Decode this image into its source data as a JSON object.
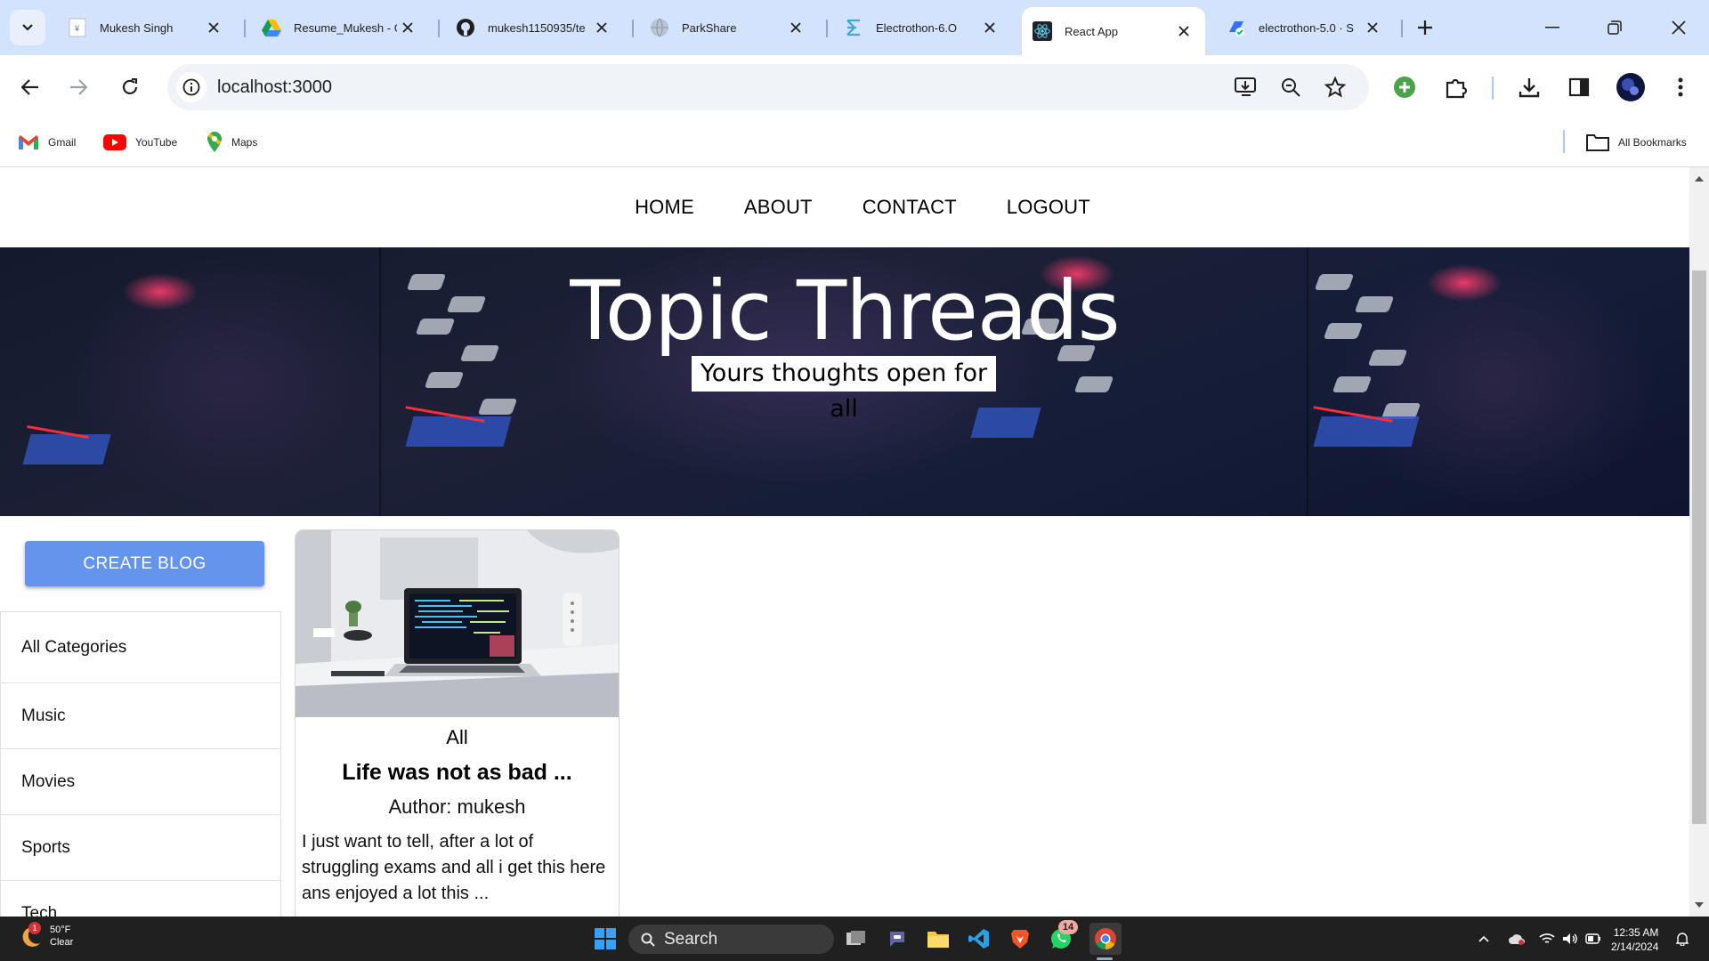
{
  "browser": {
    "tabs": [
      {
        "title": "Mukesh Singh",
        "favicon": "document-icon",
        "active": false
      },
      {
        "title": "Resume_Mukesh - G",
        "favicon": "google-drive-icon",
        "active": false
      },
      {
        "title": "mukesh1150935/te",
        "favicon": "github-icon",
        "active": false
      },
      {
        "title": "ParkShare",
        "favicon": "globe-icon",
        "active": false
      },
      {
        "title": "Electrothon-6.O",
        "favicon": "electrothon-icon",
        "active": false
      },
      {
        "title": "React App",
        "favicon": "react-icon",
        "active": true
      },
      {
        "title": "electrothon-5.0 · S",
        "favicon": "devfolio-icon",
        "active": false
      }
    ],
    "address": "localhost:3000",
    "bookmarks": [
      {
        "label": "Gmail",
        "icon": "gmail-icon"
      },
      {
        "label": "YouTube",
        "icon": "youtube-icon"
      },
      {
        "label": "Maps",
        "icon": "maps-icon"
      }
    ],
    "all_bookmarks_label": "All Bookmarks"
  },
  "page": {
    "nav": [
      "HOME",
      "ABOUT",
      "CONTACT",
      "LOGOUT"
    ],
    "banner": {
      "title": "Topic Threads",
      "subtitle": "Yours thoughts open for all"
    },
    "create_button": "CREATE BLOG",
    "categories": [
      "All Categories",
      "Music",
      "Movies",
      "Sports",
      "Tech"
    ],
    "post": {
      "category": "All",
      "title": "Life was not as bad ...",
      "author": "Author: mukesh",
      "description": "I just want to tell, after a lot of struggling exams and all i get this here ans enjoyed a lot this ..."
    }
  },
  "taskbar": {
    "weather": {
      "temp": "50°F",
      "condition": "Clear",
      "badge": "1"
    },
    "search_label": "Search",
    "whatsapp_badge": "14",
    "time": "12:35 AM",
    "date": "2/14/2024"
  },
  "colors": {
    "tabstrip": "#d3e3fd",
    "create_button": "#6495ed",
    "taskbar": "#202020"
  }
}
